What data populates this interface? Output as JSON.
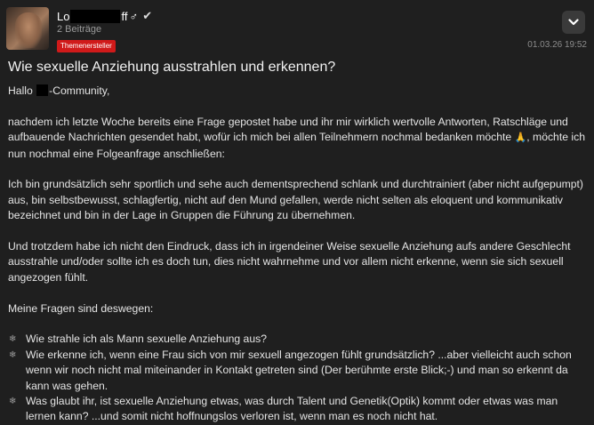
{
  "post": {
    "author": {
      "name_prefix": "Lo",
      "name_suffix": "ff",
      "gender_symbol": "♂",
      "verified_symbol": "✔",
      "post_count": "2 Beiträge",
      "badge": "Themenersteller"
    },
    "timestamp": "01.03.26 19:52",
    "title": "Wie sexuelle Anziehung ausstrahlen und erkennen?",
    "greeting_prefix": "Hallo ",
    "greeting_suffix": "-Community,",
    "paragraph_1_before_emoji": "nachdem ich letzte Woche bereits eine Frage gepostet habe und ihr mir wirklich wertvolle Antworten, Ratschläge und aufbauende Nachrichten gesendet habt, wofür ich mich bei allen Teilnehmern nochmal bedanken möchte ",
    "emoji": "🙏",
    "paragraph_1_after_emoji": ", möchte ich nun nochmal eine Folgeanfrage anschließen:",
    "paragraph_2": "Ich bin grundsätzlich sehr sportlich und sehe auch dementsprechend schlank und durchtrainiert (aber nicht aufgepumpt) aus, bin selbstbewusst, schlagfertig, nicht auf den Mund gefallen, werde nicht selten als eloquent und kommunikativ bezeichnet und bin in der Lage in Gruppen die Führung zu übernehmen.",
    "paragraph_3": "Und trotzdem habe ich nicht den Eindruck, dass ich in irgendeiner Weise sexuelle Anziehung aufs andere Geschlecht ausstrahle und/oder sollte ich es doch tun, dies nicht wahrnehme und vor allem nicht erkenne, wenn sie sich sexuell angezogen fühlt.",
    "questions_heading": "Meine Fragen sind deswegen:",
    "bullet_symbol": "❄",
    "questions": [
      {
        "text": "Wie strahle ich als Mann sexuelle Anziehung aus?"
      },
      {
        "text": "Wie erkenne ich, wenn eine Frau sich von mir sexuell angezogen fühlt grundsätzlich? ...aber vielleicht auch schon wenn wir noch nicht mal miteinander in Kontakt getreten sind (Der berühmte erste Blick;-) und man so erkennt da kann was gehen."
      },
      {
        "text": "Was glaubt ihr, ist sexuelle Anziehung etwas, was durch Talent und Genetik(Optik) kommt oder etwas was man lernen kann? ...und somit nicht hoffnungslos verloren ist, wenn man es noch nicht hat."
      }
    ]
  },
  "ui": {
    "menu_icon": "chevron-down-icon",
    "badge_color": "#d01a1a",
    "background_color": "#1f1f1f"
  }
}
